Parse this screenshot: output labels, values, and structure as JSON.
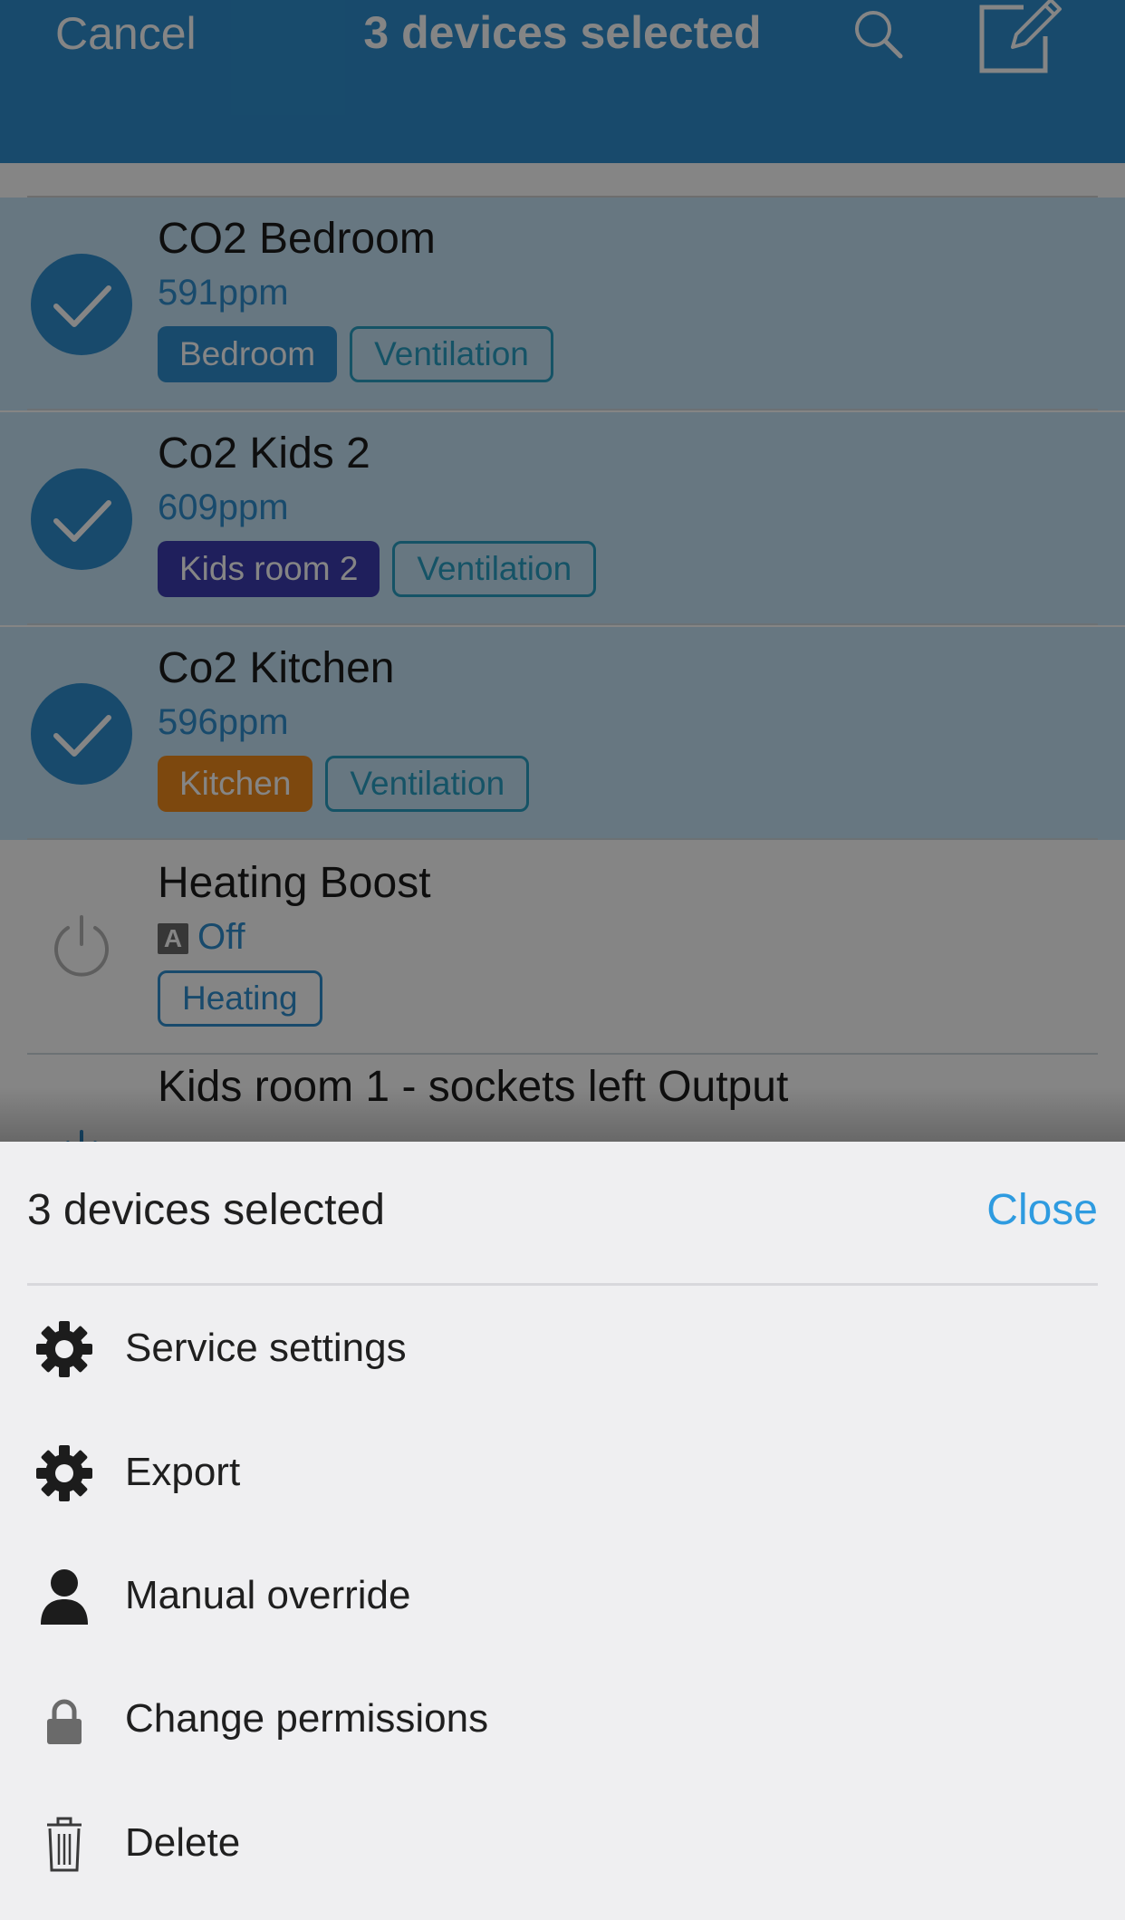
{
  "header": {
    "cancel_label": "Cancel",
    "title": "3 devices selected",
    "search_icon": "search-icon",
    "edit_icon": "edit-icon"
  },
  "devices": [
    {
      "name": "CO2 Bedroom",
      "value": "591ppm",
      "selected": true,
      "tags": [
        {
          "label": "Bedroom",
          "style": "solid",
          "color": "#2e8fd0"
        },
        {
          "label": "Ventilation",
          "style": "outline",
          "color": "#2aa0c4"
        }
      ]
    },
    {
      "name": "Co2 Kids 2",
      "value": "609ppm",
      "selected": true,
      "tags": [
        {
          "label": "Kids room 2",
          "style": "solid",
          "color": "#3d3db0"
        },
        {
          "label": "Ventilation",
          "style": "outline",
          "color": "#2aa0c4"
        }
      ]
    },
    {
      "name": "Co2 Kitchen",
      "value": "596ppm",
      "selected": true,
      "tags": [
        {
          "label": "Kitchen",
          "style": "solid",
          "color": "#f08a1c"
        },
        {
          "label": "Ventilation",
          "style": "outline",
          "color": "#2aa0c4"
        }
      ]
    },
    {
      "name": "Heating Boost",
      "value": "Off",
      "value_prefix": "A",
      "selected": false,
      "tags": [
        {
          "label": "Heating",
          "style": "outline",
          "color": "#2e8fd0"
        }
      ]
    },
    {
      "name": "Kids room 1 - sockets left Output",
      "value": "",
      "selected": false,
      "tags": []
    }
  ],
  "sheet": {
    "title": "3 devices selected",
    "close_label": "Close",
    "actions": [
      {
        "label": "Service settings",
        "icon": "gear-icon"
      },
      {
        "label": "Export",
        "icon": "gear-icon"
      },
      {
        "label": "Manual override",
        "icon": "person-icon"
      },
      {
        "label": "Change permissions",
        "icon": "lock-icon"
      },
      {
        "label": "Delete",
        "icon": "trash-icon"
      }
    ]
  },
  "colors": {
    "accent": "#2e8fd0",
    "selected_row": "#c6e4f7",
    "sheet_bg": "#efeff1"
  }
}
